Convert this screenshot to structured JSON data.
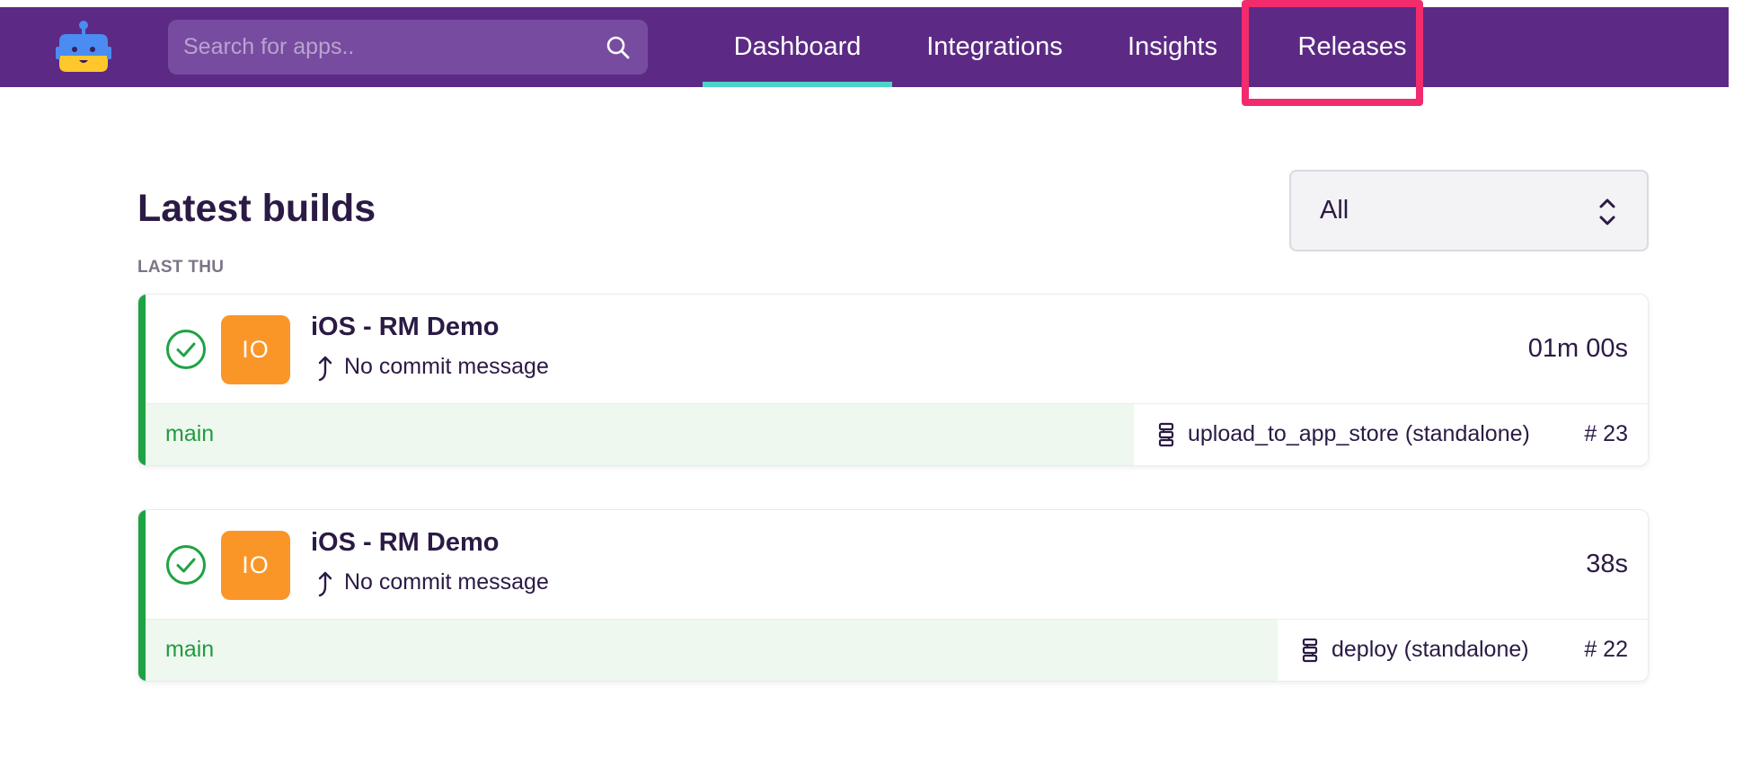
{
  "header": {
    "search_placeholder": "Search for apps..",
    "search_value": "",
    "tabs": [
      {
        "label": "Dashboard",
        "active": true
      },
      {
        "label": "Integrations",
        "active": false
      },
      {
        "label": "Insights",
        "active": false
      },
      {
        "label": "Releases",
        "active": false
      }
    ],
    "highlighted_tab": "Releases"
  },
  "main": {
    "title": "Latest builds",
    "filter": {
      "selected": "All",
      "icon": "chevron-updown-icon"
    },
    "group_label": "LAST THU",
    "builds": [
      {
        "status": "success",
        "status_icon": "check-circle-icon",
        "app_initials": "IO",
        "app_name": "iOS - RM Demo",
        "commit_icon": "commit-arrow-icon",
        "commit_message": "No commit message",
        "duration": "01m 00s",
        "branch": "main",
        "workflow_icon": "workflow-icon",
        "workflow": "upload_to_app_store (standalone)",
        "build_number": "# 23"
      },
      {
        "status": "success",
        "status_icon": "check-circle-icon",
        "app_initials": "IO",
        "app_name": "iOS - RM Demo",
        "commit_icon": "commit-arrow-icon",
        "commit_message": "No commit message",
        "duration": "38s",
        "branch": "main",
        "workflow_icon": "workflow-icon",
        "workflow": "deploy (standalone)",
        "build_number": "# 22"
      }
    ]
  },
  "colors": {
    "topbar": "#5c2a84",
    "active_tab_underline": "#4dd4c6",
    "highlight": "#f22c6c",
    "success": "#1ea344",
    "app_avatar": "#fa9628"
  }
}
